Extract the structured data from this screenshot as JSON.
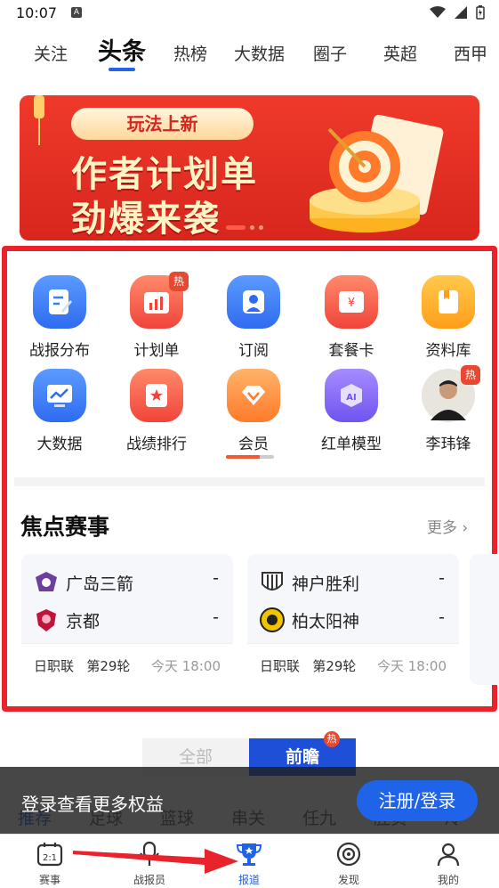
{
  "status_bar": {
    "time": "10:07",
    "notification_badge": "A"
  },
  "top_tabs": [
    {
      "label": "关注"
    },
    {
      "label": "头条",
      "active": true
    },
    {
      "label": "热榜"
    },
    {
      "label": "大数据"
    },
    {
      "label": "圈子"
    },
    {
      "label": "英超"
    },
    {
      "label": "西甲"
    }
  ],
  "banner": {
    "pill": "玩法上新",
    "line1": "作者计划单",
    "line2": "劲爆来袭"
  },
  "icon_grid": [
    {
      "label": "战报分布",
      "icon": "report-icon",
      "color": "#3a7bff"
    },
    {
      "label": "计划单",
      "icon": "plan-chart-icon",
      "color": "#ff5a4a",
      "badge": "热"
    },
    {
      "label": "订阅",
      "icon": "subscribe-person-icon",
      "color": "#3a7bff"
    },
    {
      "label": "套餐卡",
      "icon": "package-card-icon",
      "color": "#ff5a4a"
    },
    {
      "label": "资料库",
      "icon": "book-icon",
      "color": "#ffb020"
    },
    {
      "label": "大数据",
      "icon": "data-monitor-icon",
      "color": "#3a7bff"
    },
    {
      "label": "战绩排行",
      "icon": "rank-star-icon",
      "color": "#ff5a4a"
    },
    {
      "label": "会员",
      "icon": "vip-diamond-icon",
      "color": "#ff9a3a"
    },
    {
      "label": "红单模型",
      "icon": "ai-cube-icon",
      "color": "#8a6bff"
    },
    {
      "label": "李玮锋",
      "icon": "person-avatar",
      "color": "#666",
      "badge": "热"
    }
  ],
  "focus": {
    "title": "焦点赛事",
    "more": "更多",
    "matches": [
      {
        "home": "广岛三箭",
        "away": "京都",
        "home_score": "-",
        "away_score": "-",
        "league": "日职联",
        "round": "第29轮",
        "time": "今天 18:00",
        "home_color": "#6b3fa0",
        "away_color": "#c0143c"
      },
      {
        "home": "神户胜利",
        "away": "柏太阳神",
        "home_score": "-",
        "away_score": "-",
        "league": "日职联",
        "round": "第29轮",
        "time": "今天 18:00",
        "home_color": "#333333",
        "away_color": "#f2c400"
      }
    ]
  },
  "segment": {
    "all": "全部",
    "preview": "前瞻",
    "preview_badge": "热"
  },
  "sport_tabs": [
    "推荐",
    "足球",
    "篮球",
    "串关",
    "任九",
    "胜负",
    "冷"
  ],
  "toast": {
    "text": "登录查看更多权益",
    "button": "注册/登录"
  },
  "bottom_nav": [
    {
      "label": "赛事",
      "icon": "scoreboard-icon"
    },
    {
      "label": "战报员",
      "icon": "mic-icon"
    },
    {
      "label": "报道",
      "icon": "trophy-icon",
      "active": true
    },
    {
      "label": "发现",
      "icon": "discover-icon"
    },
    {
      "label": "我的",
      "icon": "profile-icon"
    }
  ],
  "colors": {
    "accent": "#1f63e8",
    "highlight_frame": "#e8232b",
    "hot": "#e8482f"
  }
}
